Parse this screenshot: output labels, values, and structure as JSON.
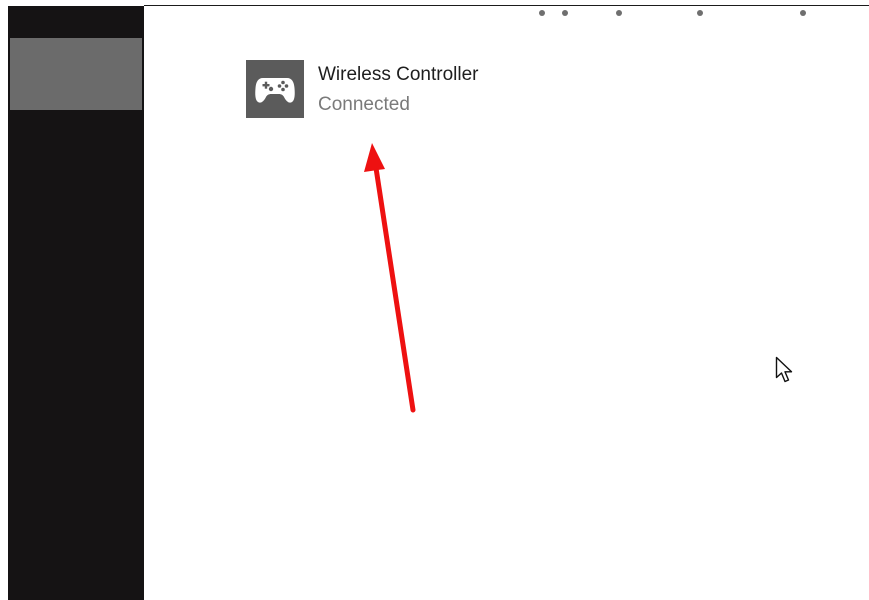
{
  "device": {
    "name": "Wireless Controller",
    "status": "Connected",
    "icon": "gamepad-icon"
  },
  "sidebar": {
    "selected_item": true
  },
  "colors": {
    "sidebar_bg": "#151314",
    "sidebar_selected": "#6b6b6b",
    "icon_tile": "#5b5b5b",
    "arrow": "#ee1111"
  }
}
